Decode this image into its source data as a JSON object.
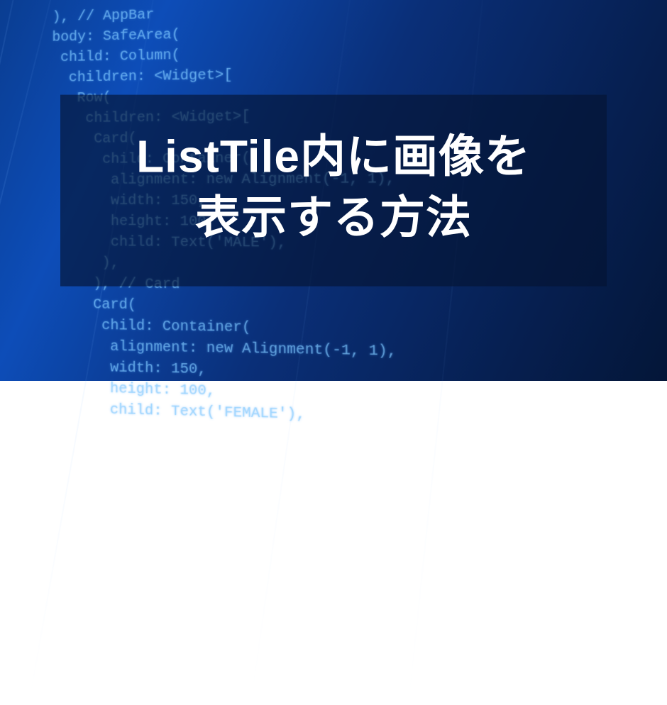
{
  "title": {
    "line1": "ListTile内に画像を",
    "line2": "表示する方法"
  },
  "code_lines": [
    "  ), // AppBar",
    "  body: SafeArea(",
    "   child: Column(",
    "    children: <Widget>[",
    "     Row(",
    "      children: <Widget>[",
    "       Card(",
    "        child: Container(",
    "         alignment: new Alignment(-1, 1),",
    "         width: 150,",
    "         height: 100,",
    "         child: Text('MALE'),",
    "        ),",
    "       ), // Card",
    "       Card(",
    "        child: Container(",
    "         alignment: new Alignment(-1, 1),",
    "         width: 150,",
    "         height: 100,",
    "         child: Text('FEMALE'),"
  ]
}
